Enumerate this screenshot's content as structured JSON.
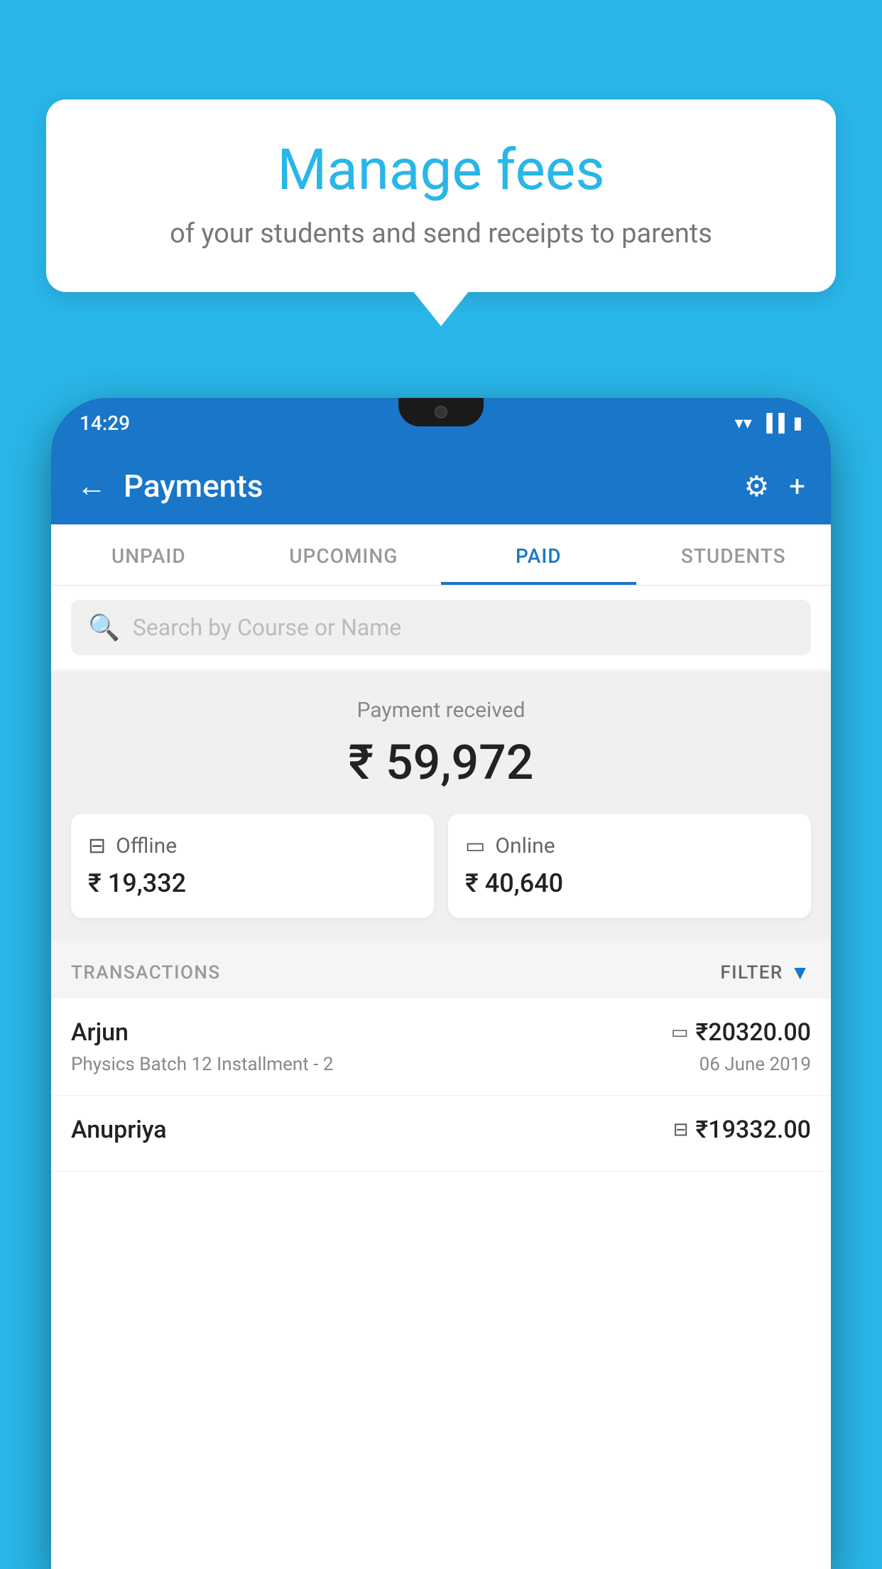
{
  "background_color": "#29b6e8",
  "bubble": {
    "title": "Manage fees",
    "subtitle": "of your students and send receipts to parents"
  },
  "status_bar": {
    "time": "14:29",
    "icons": [
      "wifi",
      "signal",
      "battery"
    ]
  },
  "header": {
    "title": "Payments",
    "back_label": "←",
    "settings_label": "⚙",
    "add_label": "+"
  },
  "tabs": [
    {
      "label": "UNPAID",
      "active": false
    },
    {
      "label": "UPCOMING",
      "active": false
    },
    {
      "label": "PAID",
      "active": true
    },
    {
      "label": "STUDENTS",
      "active": false
    }
  ],
  "search": {
    "placeholder": "Search by Course or Name"
  },
  "payment_summary": {
    "label": "Payment received",
    "total_amount": "₹ 59,972",
    "offline": {
      "type": "Offline",
      "amount": "₹ 19,332"
    },
    "online": {
      "type": "Online",
      "amount": "₹ 40,640"
    }
  },
  "transactions": {
    "label": "TRANSACTIONS",
    "filter_label": "FILTER",
    "items": [
      {
        "name": "Arjun",
        "detail": "Physics Batch 12 Installment - 2",
        "amount": "₹20320.00",
        "date": "06 June 2019",
        "type": "online"
      },
      {
        "name": "Anupriya",
        "detail": "",
        "amount": "₹19332.00",
        "date": "",
        "type": "offline"
      }
    ]
  }
}
